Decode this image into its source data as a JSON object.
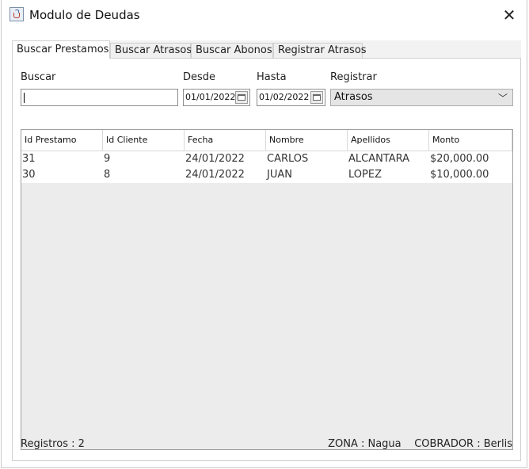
{
  "window": {
    "title": "Modulo de Deudas",
    "close_glyph": "✕",
    "app_icon": "java-cup-icon"
  },
  "tabs": [
    {
      "label": "Buscar Prestamos",
      "active": true
    },
    {
      "label": "Buscar Atrasos",
      "active": false
    },
    {
      "label": "Buscar Abonos",
      "active": false
    },
    {
      "label": "Registrar Atrasos",
      "active": false
    }
  ],
  "filters": {
    "buscar_label": "Buscar",
    "buscar_value": "",
    "desde_label": "Desde",
    "desde_value": "01/01/2022",
    "hasta_label": "Hasta",
    "hasta_value": "01/02/2022",
    "registrar_label": "Registrar",
    "registrar_value": "Atrasos"
  },
  "table": {
    "columns": [
      "Id Prestamo",
      "Id Cliente",
      "Fecha",
      "Nombre",
      "Apellidos",
      "Monto"
    ],
    "rows": [
      [
        "31",
        "9",
        "24/01/2022",
        "CARLOS",
        "ALCANTARA",
        "$20,000.00"
      ],
      [
        "30",
        "8",
        "24/01/2022",
        "JUAN",
        "LOPEZ",
        "$10,000.00"
      ]
    ]
  },
  "footer": {
    "registros": "Registros : 2",
    "zona": "ZONA : Nagua",
    "cobrador": "COBRADOR : Berlis"
  }
}
